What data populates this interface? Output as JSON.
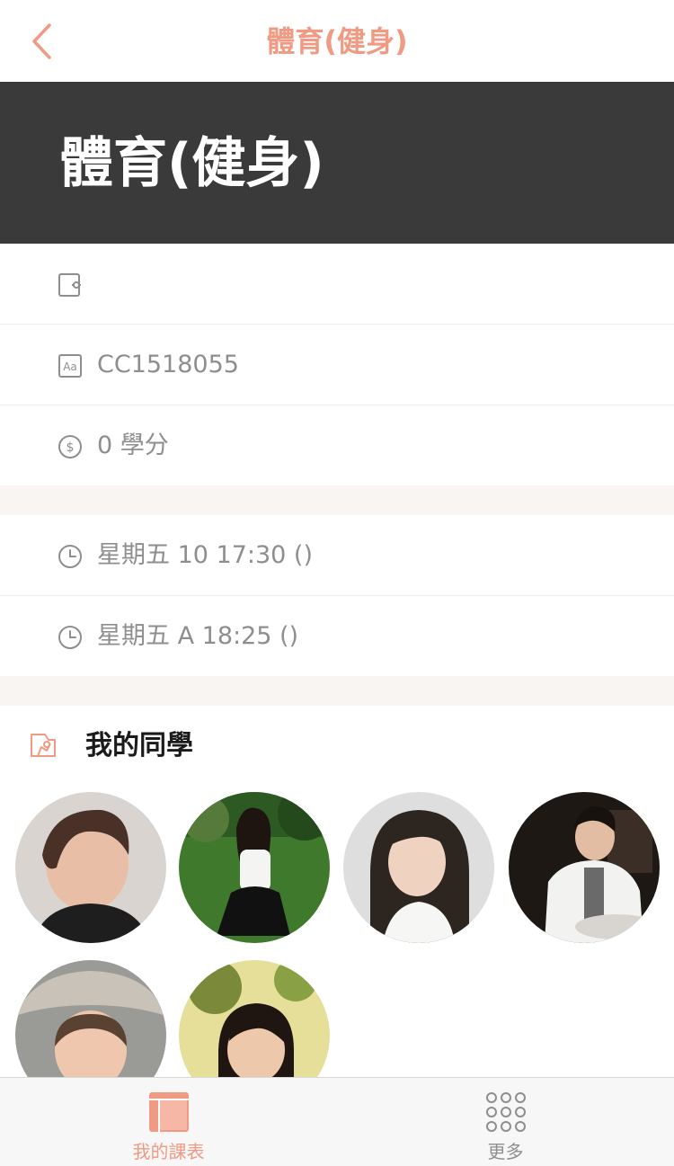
{
  "header": {
    "title": "體育(健身)",
    "back_icon": "chevron-left-icon"
  },
  "banner": {
    "course_title": "體育(健身)"
  },
  "info": {
    "room_icon": "door-icon",
    "room": "",
    "code_icon": "text-aa-icon",
    "code": "CC1518055",
    "credits_icon": "dollar-coin-icon",
    "credits": "0 學分"
  },
  "schedule": [
    {
      "icon": "clock-icon",
      "text": "星期五 10 17:30 ()"
    },
    {
      "icon": "clock-icon",
      "text": "星期五 A 18:25 ()"
    }
  ],
  "classmates": {
    "icon": "people-icon",
    "title": "我的同學",
    "count": 6
  },
  "tabbar": {
    "tabs": [
      {
        "label": "我的課表",
        "icon": "timetable-icon",
        "active": true
      },
      {
        "label": "更多",
        "icon": "grid-dots-icon",
        "active": false
      }
    ]
  },
  "colors": {
    "accent": "#f09a84",
    "banner_bg": "#3a3a3a",
    "section_gap": "#f9f5f3",
    "muted_text": "#8e8e8e"
  }
}
